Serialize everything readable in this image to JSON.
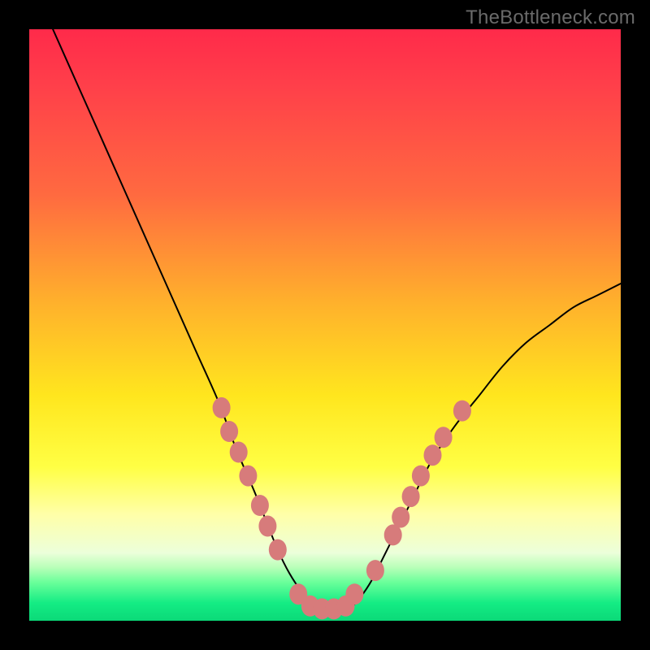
{
  "watermark": "TheBottleneck.com",
  "colors": {
    "frame": "#000000",
    "watermark": "#6a6a6a",
    "curve": "#000000",
    "dot": "#d77b7b"
  },
  "chart_data": {
    "type": "line",
    "title": "",
    "xlabel": "",
    "ylabel": "",
    "xlim": [
      0,
      100
    ],
    "ylim": [
      0,
      100
    ],
    "curve": {
      "x": [
        4,
        8,
        12,
        16,
        20,
        24,
        28,
        32,
        35,
        38,
        40,
        42,
        44,
        46,
        48,
        50,
        52,
        54,
        56,
        58,
        60,
        64,
        68,
        72,
        76,
        80,
        84,
        88,
        92,
        96,
        100
      ],
      "y": [
        100,
        91,
        82,
        73,
        64,
        55,
        46,
        37,
        29,
        22,
        17,
        12,
        8,
        5,
        3,
        2,
        2,
        2,
        4,
        7,
        11,
        19,
        27,
        33,
        38,
        43,
        47,
        50,
        53,
        55,
        57
      ]
    },
    "points": [
      {
        "x": 32.5,
        "y": 36
      },
      {
        "x": 33.8,
        "y": 32
      },
      {
        "x": 35.4,
        "y": 28.5
      },
      {
        "x": 37.0,
        "y": 24.5
      },
      {
        "x": 39.0,
        "y": 19.5
      },
      {
        "x": 40.3,
        "y": 16
      },
      {
        "x": 42.0,
        "y": 12
      },
      {
        "x": 45.5,
        "y": 4.5
      },
      {
        "x": 47.5,
        "y": 2.5
      },
      {
        "x": 49.5,
        "y": 2.0
      },
      {
        "x": 51.5,
        "y": 2.0
      },
      {
        "x": 53.5,
        "y": 2.5
      },
      {
        "x": 55.0,
        "y": 4.5
      },
      {
        "x": 58.5,
        "y": 8.5
      },
      {
        "x": 61.5,
        "y": 14.5
      },
      {
        "x": 62.8,
        "y": 17.5
      },
      {
        "x": 64.5,
        "y": 21
      },
      {
        "x": 66.2,
        "y": 24.5
      },
      {
        "x": 68.2,
        "y": 28
      },
      {
        "x": 70.0,
        "y": 31
      },
      {
        "x": 73.2,
        "y": 35.5
      }
    ]
  }
}
